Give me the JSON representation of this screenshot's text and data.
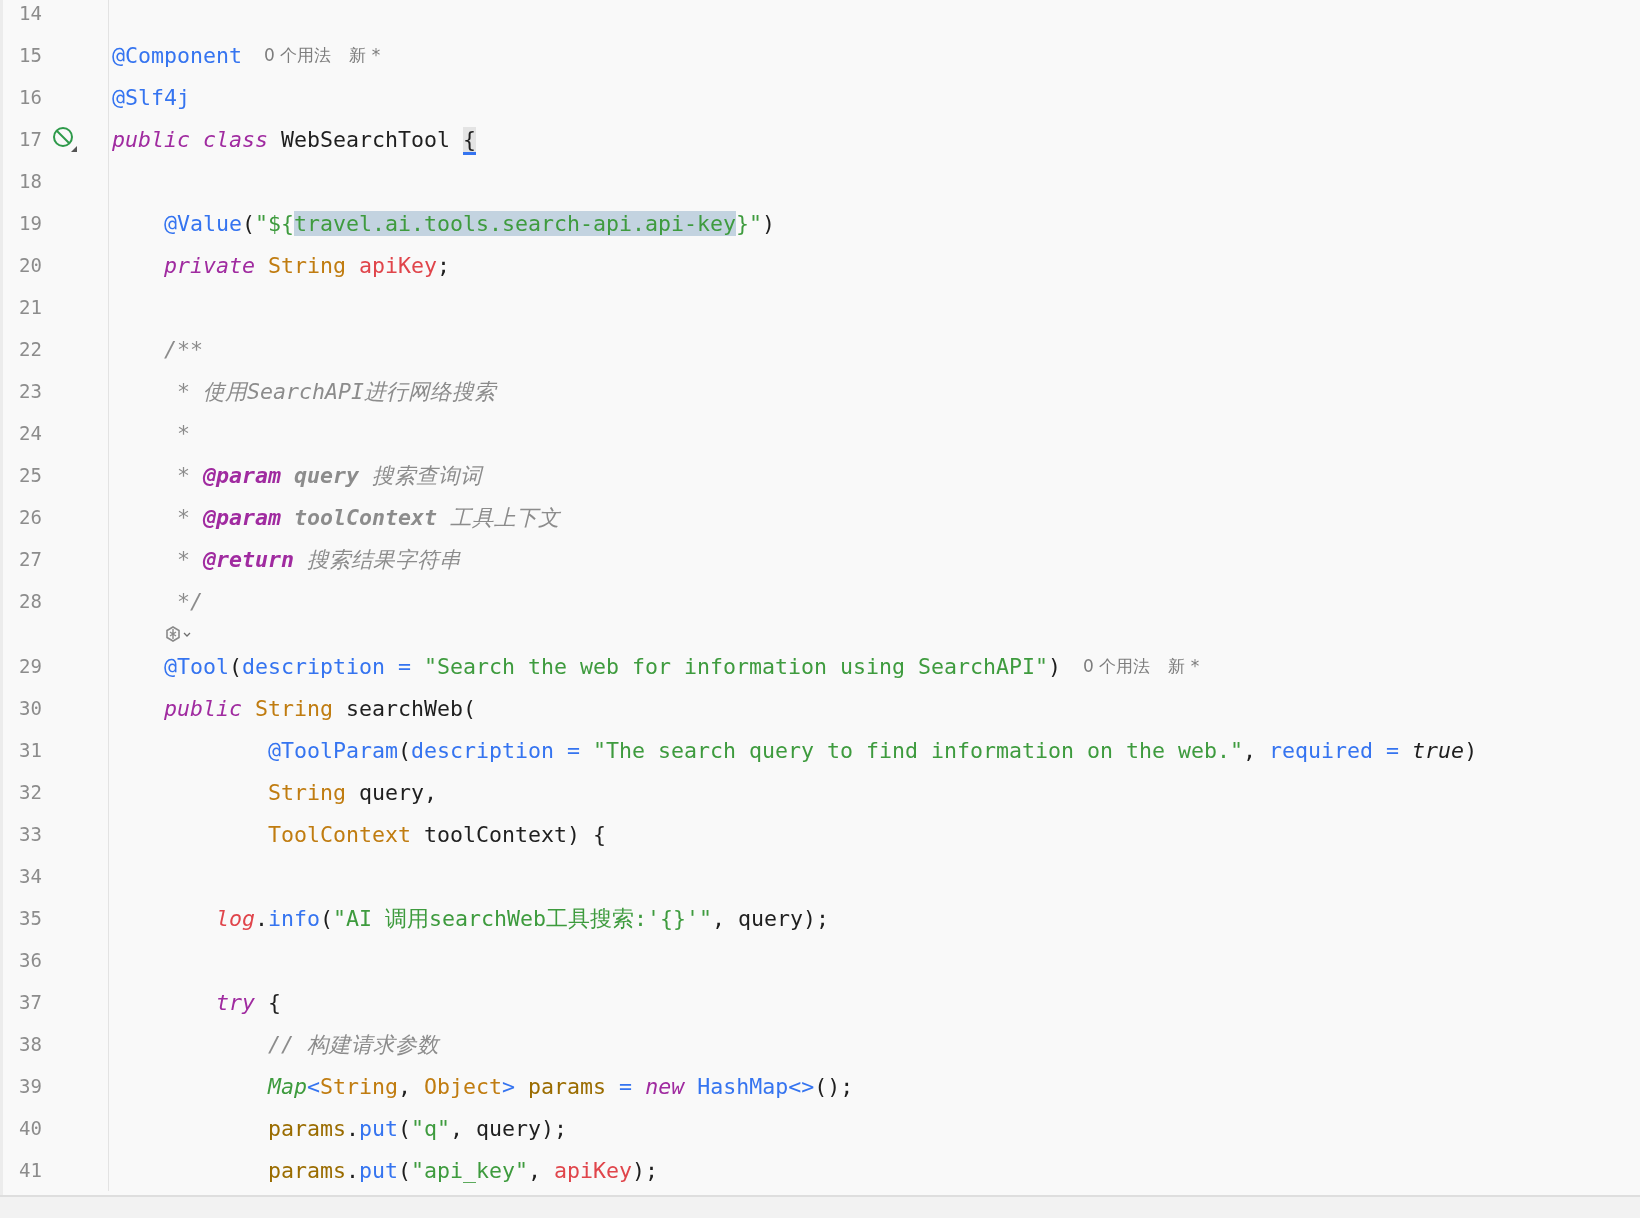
{
  "editor": {
    "lines": [
      {
        "kind": "code",
        "number": "14"
      },
      {
        "kind": "code",
        "number": "15",
        "tokens": [
          {
            "text": "@Component",
            "kind": "annotation"
          }
        ],
        "hints": [
          "0 个用法",
          "新 *"
        ]
      },
      {
        "kind": "code",
        "number": "16",
        "tokens": [
          {
            "text": "@Slf4j",
            "kind": "annotation"
          }
        ]
      },
      {
        "kind": "code",
        "number": "17",
        "gutter_marker": true,
        "tokens": [
          {
            "text": "public class",
            "kind": "keyword"
          },
          {
            "text": " WebSearchTool ",
            "kind": "plain"
          },
          {
            "text": "{",
            "kind": "plain",
            "brace_match": true
          }
        ]
      },
      {
        "kind": "code",
        "number": "18"
      },
      {
        "kind": "code",
        "number": "19",
        "tokens": [
          {
            "text": "    @Value",
            "kind": "annotation"
          },
          {
            "text": "(",
            "kind": "plain"
          },
          {
            "text": "\"${",
            "kind": "string"
          },
          {
            "text": "travel.ai.tools.search-api.api-key",
            "kind": "string",
            "selected": true
          },
          {
            "text": "}\"",
            "kind": "string"
          },
          {
            "text": ")",
            "kind": "plain"
          }
        ]
      },
      {
        "kind": "code",
        "number": "20",
        "tokens": [
          {
            "text": "    private",
            "kind": "keyword"
          },
          {
            "text": " String",
            "kind": "type"
          },
          {
            "text": " apiKey",
            "kind": "field"
          },
          {
            "text": ";",
            "kind": "plain"
          }
        ]
      },
      {
        "kind": "code",
        "number": "21"
      },
      {
        "kind": "code",
        "number": "22",
        "tokens": [
          {
            "text": "    /**",
            "kind": "comment"
          }
        ]
      },
      {
        "kind": "code",
        "number": "23",
        "tokens": [
          {
            "text": "     * 使用SearchAPI进行网络搜索",
            "kind": "comment"
          }
        ]
      },
      {
        "kind": "code",
        "number": "24",
        "tokens": [
          {
            "text": "     *",
            "kind": "comment"
          }
        ]
      },
      {
        "kind": "code",
        "number": "25",
        "tokens": [
          {
            "text": "     * ",
            "kind": "comment"
          },
          {
            "text": "@param",
            "kind": "doctag"
          },
          {
            "text": " query",
            "kind": "docparam"
          },
          {
            "text": " 搜索查询词",
            "kind": "comment"
          }
        ]
      },
      {
        "kind": "code",
        "number": "26",
        "tokens": [
          {
            "text": "     * ",
            "kind": "comment"
          },
          {
            "text": "@param",
            "kind": "doctag"
          },
          {
            "text": " toolContext",
            "kind": "docparam"
          },
          {
            "text": " 工具上下文",
            "kind": "comment"
          }
        ]
      },
      {
        "kind": "code",
        "number": "27",
        "tokens": [
          {
            "text": "     * ",
            "kind": "comment"
          },
          {
            "text": "@return",
            "kind": "doctag"
          },
          {
            "text": " 搜索结果字符串",
            "kind": "comment"
          }
        ]
      },
      {
        "kind": "code",
        "number": "28",
        "tokens": [
          {
            "text": "     */",
            "kind": "comment"
          }
        ]
      },
      {
        "kind": "ai-hint"
      },
      {
        "kind": "code",
        "number": "29",
        "tokens": [
          {
            "text": "    @Tool",
            "kind": "annotation"
          },
          {
            "text": "(",
            "kind": "plain"
          },
          {
            "text": "description = ",
            "kind": "annotation"
          },
          {
            "text": "\"Search the web for information using SearchAPI\"",
            "kind": "string"
          },
          {
            "text": ")",
            "kind": "plain"
          }
        ],
        "hints": [
          "0 个用法",
          "新 *"
        ]
      },
      {
        "kind": "code",
        "number": "30",
        "tokens": [
          {
            "text": "    public",
            "kind": "keyword"
          },
          {
            "text": " String",
            "kind": "type"
          },
          {
            "text": " searchWeb(",
            "kind": "plain"
          }
        ]
      },
      {
        "kind": "code",
        "number": "31",
        "tokens": [
          {
            "text": "            @ToolParam",
            "kind": "annotation"
          },
          {
            "text": "(",
            "kind": "plain"
          },
          {
            "text": "description = ",
            "kind": "annotation"
          },
          {
            "text": "\"The search query to find information on the web.\"",
            "kind": "string"
          },
          {
            "text": ", ",
            "kind": "plain"
          },
          {
            "text": "required = ",
            "kind": "annotation"
          },
          {
            "text": "true",
            "kind": "literal"
          },
          {
            "text": ")",
            "kind": "plain"
          }
        ]
      },
      {
        "kind": "code",
        "number": "32",
        "tokens": [
          {
            "text": "            String",
            "kind": "type"
          },
          {
            "text": " query,",
            "kind": "plain"
          }
        ]
      },
      {
        "kind": "code",
        "number": "33",
        "tokens": [
          {
            "text": "            ToolContext",
            "kind": "type"
          },
          {
            "text": " toolContext) {",
            "kind": "plain"
          }
        ]
      },
      {
        "kind": "code",
        "number": "34"
      },
      {
        "kind": "code",
        "number": "35",
        "tokens": [
          {
            "text": "        log",
            "kind": "static"
          },
          {
            "text": ".",
            "kind": "plain"
          },
          {
            "text": "info",
            "kind": "method"
          },
          {
            "text": "(",
            "kind": "plain"
          },
          {
            "text": "\"AI 调用searchWeb工具搜索:'{}'\"",
            "kind": "string"
          },
          {
            "text": ", query);",
            "kind": "plain"
          }
        ]
      },
      {
        "kind": "code",
        "number": "36"
      },
      {
        "kind": "code",
        "number": "37",
        "tokens": [
          {
            "text": "        try",
            "kind": "keyword"
          },
          {
            "text": " {",
            "kind": "plain"
          }
        ]
      },
      {
        "kind": "code",
        "number": "38",
        "tokens": [
          {
            "text": "            // 构建请求参数",
            "kind": "comment"
          }
        ]
      },
      {
        "kind": "code",
        "number": "39",
        "tokens": [
          {
            "text": "            Map",
            "kind": "interface"
          },
          {
            "text": "<",
            "kind": "method"
          },
          {
            "text": "String",
            "kind": "type"
          },
          {
            "text": ", ",
            "kind": "plain"
          },
          {
            "text": "Object",
            "kind": "type"
          },
          {
            "text": ">",
            "kind": "method"
          },
          {
            "text": " params",
            "kind": "local"
          },
          {
            "text": " = ",
            "kind": "method"
          },
          {
            "text": "new",
            "kind": "keyword"
          },
          {
            "text": " HashMap<>",
            "kind": "method"
          },
          {
            "text": "();",
            "kind": "plain"
          }
        ]
      },
      {
        "kind": "code",
        "number": "40",
        "tokens": [
          {
            "text": "            params",
            "kind": "local"
          },
          {
            "text": ".",
            "kind": "plain"
          },
          {
            "text": "put",
            "kind": "method"
          },
          {
            "text": "(",
            "kind": "plain"
          },
          {
            "text": "\"q\"",
            "kind": "string"
          },
          {
            "text": ", query);",
            "kind": "plain"
          }
        ]
      },
      {
        "kind": "code",
        "number": "41",
        "tokens": [
          {
            "text": "            params",
            "kind": "local"
          },
          {
            "text": ".",
            "kind": "plain"
          },
          {
            "text": "put",
            "kind": "method"
          },
          {
            "text": "(",
            "kind": "plain"
          },
          {
            "text": "\"api_key\"",
            "kind": "string"
          },
          {
            "text": ", ",
            "kind": "plain"
          },
          {
            "text": "apiKey",
            "kind": "field"
          },
          {
            "text": ");",
            "kind": "plain"
          }
        ]
      }
    ]
  }
}
